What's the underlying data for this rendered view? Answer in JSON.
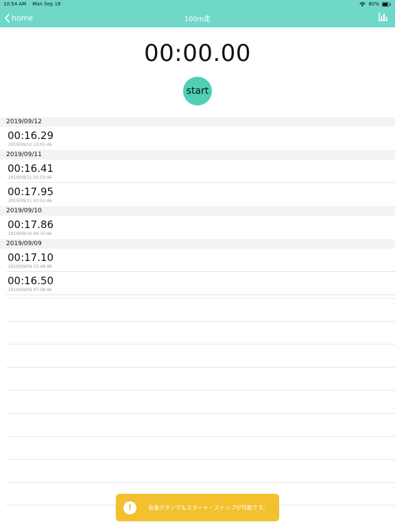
{
  "status_bar": {
    "time": "10:54 AM",
    "date": "Mon Sep 16",
    "battery": "80%",
    "battery_level": 0.8
  },
  "nav": {
    "back_label": "home",
    "title": "100m走",
    "right_icon": "bar-chart-icon"
  },
  "timer": {
    "display": "00:00.00",
    "start_label": "start"
  },
  "history": [
    {
      "date": "2019/09/12",
      "records": [
        {
          "time": "00:16.29",
          "timestamp": "2019/09/12 23:01:46"
        }
      ]
    },
    {
      "date": "2019/09/11",
      "records": [
        {
          "time": "00:16.41",
          "timestamp": "2019/09/11 02:53:46"
        },
        {
          "time": "00:17.95",
          "timestamp": "2019/09/11 02:01:46"
        }
      ]
    },
    {
      "date": "2019/09/10",
      "records": [
        {
          "time": "00:17.86",
          "timestamp": "2019/09/10 04:10:46"
        }
      ]
    },
    {
      "date": "2019/09/09",
      "records": [
        {
          "time": "00:17.10",
          "timestamp": "2019/09/09 23:48:46"
        },
        {
          "time": "00:16.50",
          "timestamp": "2019/09/09 07:08:46"
        }
      ]
    }
  ],
  "toast": {
    "icon": "!",
    "message": "音量ボタンでもスタート・ストップが可能です。"
  },
  "colors": {
    "header": "#6fd8c8",
    "start_button": "#4fcfb4",
    "toast": "#f2c12d"
  }
}
